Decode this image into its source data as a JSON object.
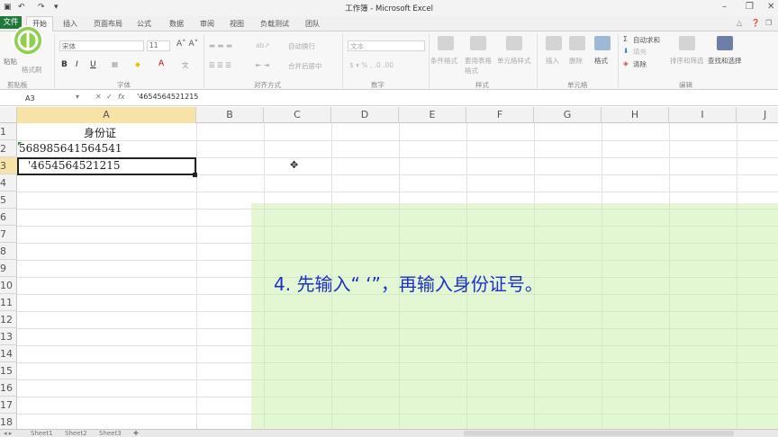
{
  "window": {
    "title": "工作簿 - Microsoft Excel"
  },
  "tabs": [
    "文件",
    "开始",
    "插入",
    "页面布局",
    "公式",
    "数据",
    "审阅",
    "视图",
    "负载测试",
    "团队"
  ],
  "ribbon": {
    "clipboard": {
      "paste": "粘贴",
      "format_painter": "格式刷",
      "group": "剪贴板"
    },
    "font": {
      "font_name": "宋体",
      "font_size": "11",
      "group": "字体"
    },
    "alignment": {
      "wrap": "自动换行",
      "merge": "合并后居中",
      "group": "对齐方式"
    },
    "number": {
      "format": "文本",
      "group": "数字"
    },
    "styles": {
      "conditional": "条件格式",
      "table": "套用表格格式",
      "cell_styles": "单元格样式",
      "group": "样式"
    },
    "cells": {
      "insert": "插入",
      "delete": "删除",
      "format": "格式",
      "group": "单元格"
    },
    "editing": {
      "autosum": "自动求和",
      "fill": "填充",
      "clear": "清除",
      "sort": "排序和筛选",
      "find": "查找和选择",
      "group": "编辑"
    }
  },
  "formula_bar": {
    "name_box": "A3",
    "fx": "fx",
    "formula": "'4654564521215"
  },
  "columns": [
    "A",
    "B",
    "C",
    "D",
    "E",
    "F",
    "G",
    "H",
    "I",
    "J"
  ],
  "rows": [
    "1",
    "2",
    "3",
    "4",
    "5",
    "6",
    "7",
    "8",
    "9",
    "10",
    "11",
    "12",
    "13",
    "14",
    "15",
    "16",
    "17",
    "18"
  ],
  "cells": {
    "A1": "身份证",
    "A2": "568985641564541",
    "A3": "'4654564521215"
  },
  "caption": "4. 先输入“ ‘”，再输入身份证号。",
  "sheets": [
    "Sheet1",
    "Sheet2",
    "Sheet3"
  ],
  "colors": {
    "accent": "#1f7a3a",
    "caption": "#1a2fd6",
    "overlay": "#cdf0af"
  }
}
